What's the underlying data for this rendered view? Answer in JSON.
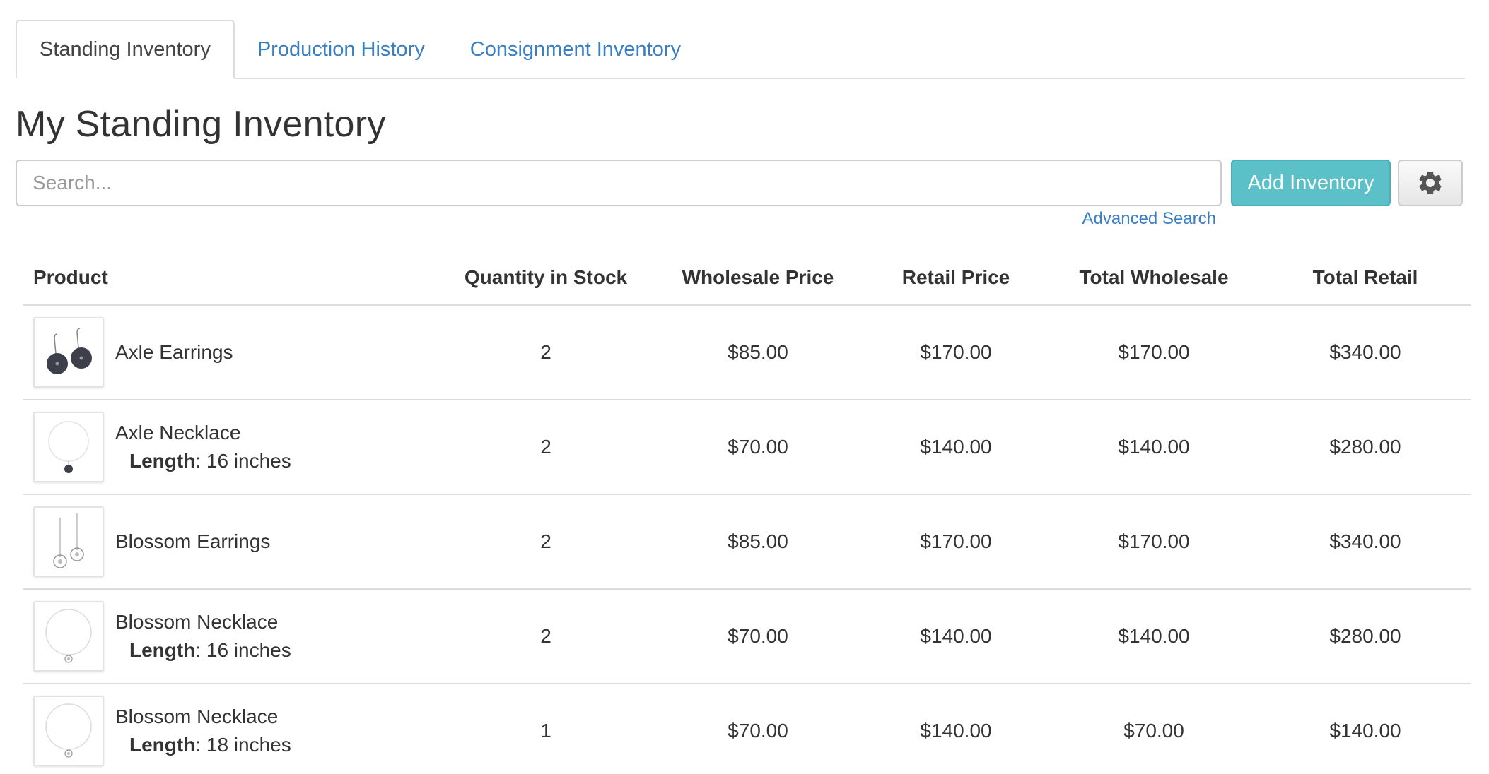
{
  "tabs": [
    {
      "label": "Standing Inventory",
      "active": true
    },
    {
      "label": "Production History",
      "active": false
    },
    {
      "label": "Consignment Inventory",
      "active": false
    }
  ],
  "page_title": "My Standing Inventory",
  "search": {
    "placeholder": "Search...",
    "value": ""
  },
  "actions": {
    "add_label": "Add Inventory",
    "settings_icon": "gear-icon",
    "advanced_search_label": "Advanced Search"
  },
  "table": {
    "headers": {
      "product": "Product",
      "quantity": "Quantity in Stock",
      "wholesale": "Wholesale Price",
      "retail": "Retail Price",
      "total_wholesale": "Total Wholesale",
      "total_retail": "Total Retail"
    },
    "rows": [
      {
        "name": "Axle Earrings",
        "option_name": "",
        "option_value": "",
        "quantity": "2",
        "wholesale": "$85.00",
        "retail": "$170.00",
        "total_wholesale": "$170.00",
        "total_retail": "$340.00",
        "thumb_icon": "axle-earrings-thumbnail"
      },
      {
        "name": "Axle Necklace",
        "option_name": "Length",
        "option_value": ": 16 inches",
        "quantity": "2",
        "wholesale": "$70.00",
        "retail": "$140.00",
        "total_wholesale": "$140.00",
        "total_retail": "$280.00",
        "thumb_icon": "axle-necklace-thumbnail"
      },
      {
        "name": "Blossom Earrings",
        "option_name": "",
        "option_value": "",
        "quantity": "2",
        "wholesale": "$85.00",
        "retail": "$170.00",
        "total_wholesale": "$170.00",
        "total_retail": "$340.00",
        "thumb_icon": "blossom-earrings-thumbnail"
      },
      {
        "name": "Blossom Necklace",
        "option_name": "Length",
        "option_value": ": 16 inches",
        "quantity": "2",
        "wholesale": "$70.00",
        "retail": "$140.00",
        "total_wholesale": "$140.00",
        "total_retail": "$280.00",
        "thumb_icon": "blossom-necklace-thumbnail"
      },
      {
        "name": "Blossom Necklace",
        "option_name": "Length",
        "option_value": ": 18 inches",
        "quantity": "1",
        "wholesale": "$70.00",
        "retail": "$140.00",
        "total_wholesale": "$70.00",
        "total_retail": "$140.00",
        "thumb_icon": "blossom-necklace-thumbnail"
      }
    ]
  },
  "colors": {
    "link": "#3a7fc1",
    "primary_button": "#5bc0c8",
    "border": "#dddddd",
    "text": "#333333"
  }
}
